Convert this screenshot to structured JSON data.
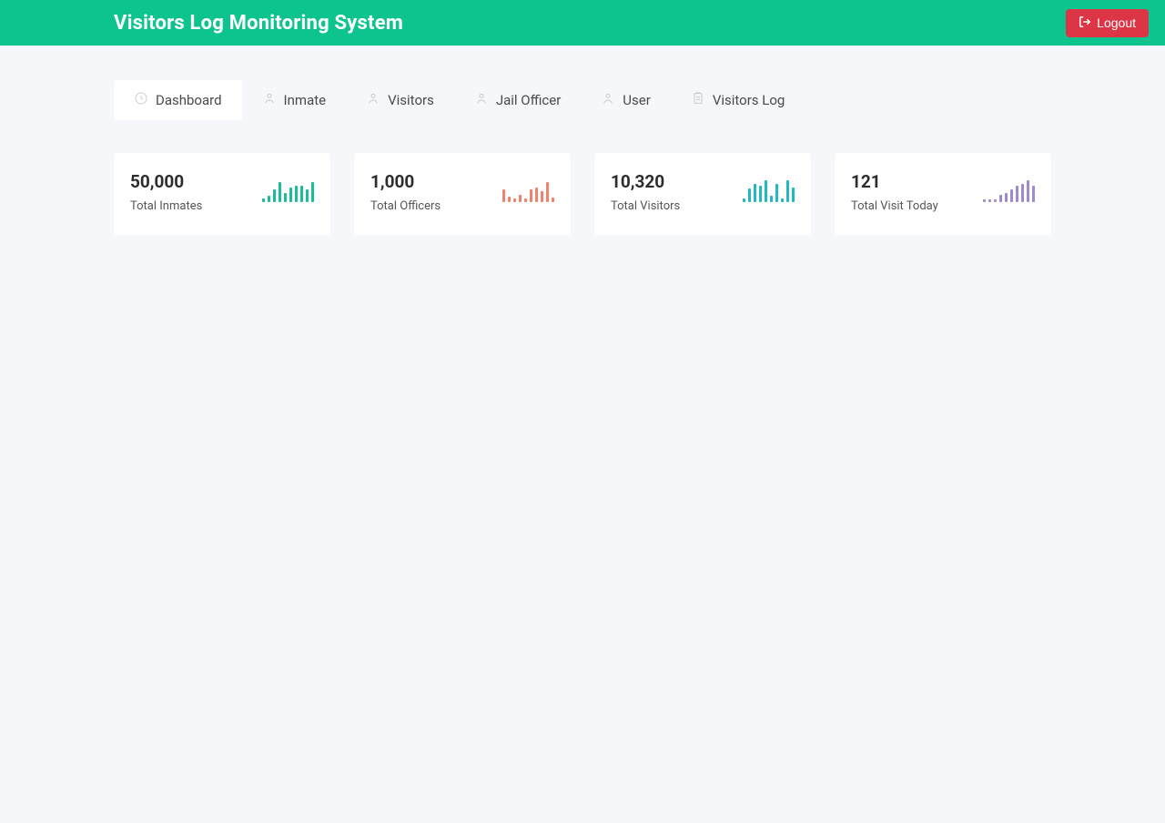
{
  "header": {
    "title": "Visitors Log Monitoring System",
    "logout_label": "Logout"
  },
  "tabs": [
    {
      "label": "Dashboard",
      "icon": "dashboard-icon",
      "active": true
    },
    {
      "label": "Inmate",
      "icon": "person-icon",
      "active": false
    },
    {
      "label": "Visitors",
      "icon": "person-icon",
      "active": false
    },
    {
      "label": "Jail Officer",
      "icon": "person-icon",
      "active": false
    },
    {
      "label": "User",
      "icon": "person-icon",
      "active": false
    },
    {
      "label": "Visitors Log",
      "icon": "clipboard-icon",
      "active": false
    }
  ],
  "cards": [
    {
      "value": "50,000",
      "label": "Total Inmates",
      "spark_color": "green",
      "spark": [
        4,
        7,
        14,
        22,
        10,
        16,
        18,
        18,
        14,
        22
      ]
    },
    {
      "value": "1,000",
      "label": "Total Officers",
      "spark_color": "orange",
      "spark": [
        14,
        6,
        4,
        8,
        4,
        14,
        16,
        12,
        22,
        5
      ]
    },
    {
      "value": "10,320",
      "label": "Total Visitors",
      "spark_color": "teal",
      "spark": [
        4,
        15,
        20,
        18,
        24,
        7,
        20,
        4,
        24,
        16
      ]
    },
    {
      "value": "121",
      "label": "Total Visit Today",
      "spark_color": "purple",
      "spark": [
        3,
        3,
        3,
        8,
        10,
        14,
        18,
        20,
        24,
        18
      ]
    }
  ]
}
